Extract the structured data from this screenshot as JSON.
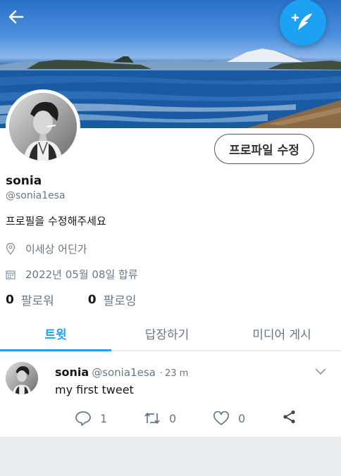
{
  "header": {
    "back_icon": "arrow-left-icon",
    "compose_icon": "feather-plus-icon",
    "accent": "#1da1f2"
  },
  "profile": {
    "edit_label": "프로파일 수정",
    "name": "sonia",
    "handle": "@sonia1esa",
    "bio": "프로필을 수정해주세요",
    "location": "이세상 어딘가",
    "joined": "2022년 05월 08일 합류",
    "followers_count": "0",
    "followers_label": "팔로워",
    "following_count": "0",
    "following_label": "팔로잉"
  },
  "tabs": [
    {
      "label": "트윗",
      "active": true
    },
    {
      "label": "답장하기",
      "active": false
    },
    {
      "label": "미디어 게시",
      "active": false
    }
  ],
  "tweet": {
    "name": "sonia",
    "handle": "@sonia1esa",
    "dot": "·",
    "time": "23 m",
    "text": "my first tweet",
    "reply_count": "1",
    "retweet_count": "0",
    "like_count": "0"
  }
}
